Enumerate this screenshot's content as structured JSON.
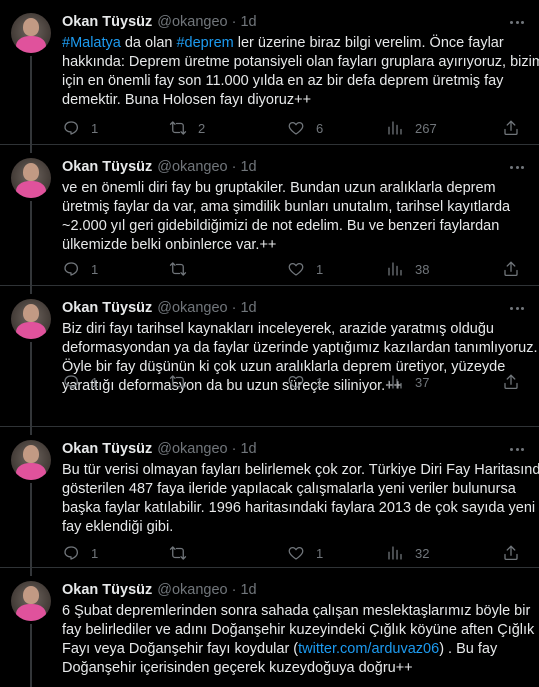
{
  "colors": {
    "background": "#000000",
    "text": "#e7e9ea",
    "muted": "#71767b",
    "link": "#1d9bf0",
    "divider": "#2f3336"
  },
  "tweets": [
    {
      "author": "Okan Tüysüz",
      "handle": "@okangeo",
      "separator": "·",
      "time": "1d",
      "lines": [
        [
          {
            "t": "#Malatya",
            "link": true
          },
          {
            "t": " da olan "
          },
          {
            "t": "#deprem",
            "link": true
          },
          {
            "t": " ler üzerine biraz bilgi verelim. Önce faylar"
          }
        ],
        [
          {
            "t": "hakkında: Deprem üretme potansiyeli olan fayları gruplara ayırıyoruz, bizim"
          }
        ],
        [
          {
            "t": "için en önemli fay son 11.000 yılda en az bir defa deprem üretmiş fay"
          }
        ],
        [
          {
            "t": "demektir. Buna Holosen fayı diyoruz++"
          }
        ]
      ],
      "replies": "1",
      "retweets": "2",
      "likes": "6",
      "views": "267"
    },
    {
      "author": "Okan Tüysüz",
      "handle": "@okangeo",
      "separator": "·",
      "time": "1d",
      "lines": [
        [
          {
            "t": "ve en önemli diri fay bu gruptakiler. Bundan uzun aralıklarla deprem"
          }
        ],
        [
          {
            "t": "üretmiş faylar da var, ama şimdilik bunları unutalım, tarihsel kayıtlarda"
          }
        ],
        [
          {
            "t": "~2.000 yıl geri gidebildiğimizi de not edelim. Bu ve benzeri faylardan"
          }
        ],
        [
          {
            "t": "ülkemizde belki onbinlerce var.++"
          }
        ]
      ],
      "replies": "1",
      "retweets": "",
      "likes": "1",
      "views": "38"
    },
    {
      "author": "Okan Tüysüz",
      "handle": "@okangeo",
      "separator": "·",
      "time": "1d",
      "lines": [
        [
          {
            "t": "Biz diri fayı tarihsel kaynakları inceleyerek, arazide yaratmış olduğu"
          }
        ],
        [
          {
            "t": "deformasyondan ya da faylar üzerinde yaptığımız kazılardan tanımlıyoruz."
          }
        ],
        [
          {
            "t": "Öyle bir fay düşünün ki çok uzun aralıklarla deprem üretiyor, yüzeyde"
          }
        ],
        [
          {
            "t": "yarattığı deformasyon da bu uzun süreçte siliniyor.++"
          }
        ]
      ],
      "replies": "1",
      "retweets": "",
      "likes": "1",
      "views": "37"
    },
    {
      "author": "Okan Tüysüz",
      "handle": "@okangeo",
      "separator": "·",
      "time": "1d",
      "lines": [
        [
          {
            "t": "Bu tür verisi olmayan fayları belirlemek çok zor. Türkiye Diri Fay Haritasında"
          }
        ],
        [
          {
            "t": "gösterilen 487 faya ileride yapılacak çalışmalarla yeni veriler bulunursa"
          }
        ],
        [
          {
            "t": "başka faylar katılabilir. 1996 haritasındaki faylara 2013 de çok sayıda yeni"
          }
        ],
        [
          {
            "t": "fay eklendiği gibi."
          }
        ]
      ],
      "replies": "1",
      "retweets": "",
      "likes": "1",
      "views": "32"
    },
    {
      "author": "Okan Tüysüz",
      "handle": "@okangeo",
      "separator": "·",
      "time": "1d",
      "lines": [
        [
          {
            "t": "6 Şubat depremlerinden sonra sahada çalışan meslektaşlarımız böyle bir"
          }
        ],
        [
          {
            "t": "fay belirlediler ve adını Doğanşehir kuzeyindeki Çığlık köyüne aften Çığlık"
          }
        ],
        [
          {
            "t": "Fayı veya Doğanşehir fayı koydular ("
          },
          {
            "t": "twitter.com/arduvaz06",
            "link": true
          },
          {
            "t": ") . Bu fay"
          }
        ],
        [
          {
            "t": "Doğanşehir içerisinden geçerek kuzeydoğuya doğru++"
          }
        ]
      ],
      "replies": "",
      "retweets": "",
      "likes": "",
      "views": ""
    }
  ]
}
